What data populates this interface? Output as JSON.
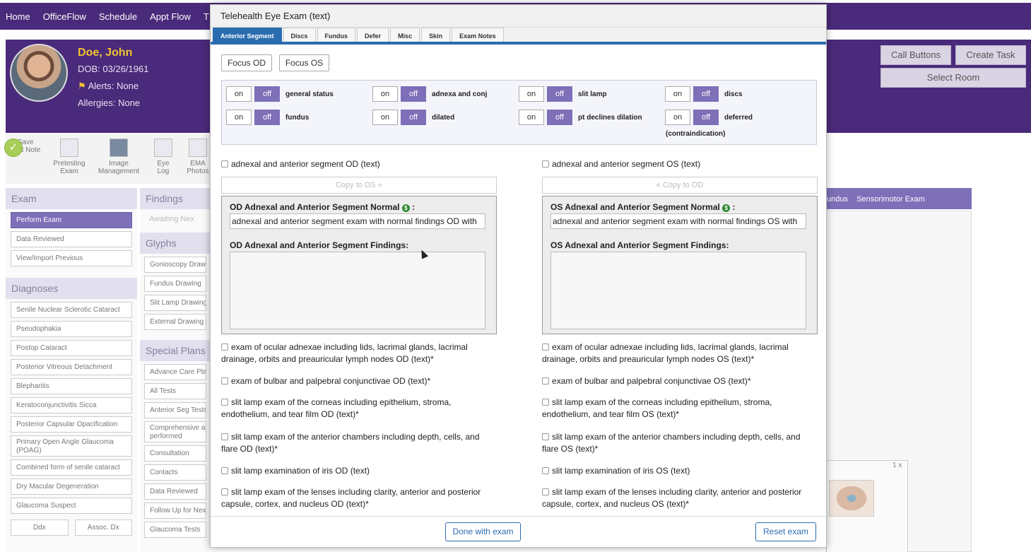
{
  "nav": {
    "items": [
      "Home",
      "OfficeFlow",
      "Schedule",
      "Appt Flow",
      "T"
    ]
  },
  "patient": {
    "name": "Doe, John",
    "dob": "DOB: 03/26/1961",
    "alerts": "Alerts: None",
    "allergies": "Allergies: None"
  },
  "header_buttons": {
    "call": "Call Buttons",
    "task": "Create Task",
    "room": "Select Room"
  },
  "toolbar": [
    {
      "label1": "Save",
      "label2": "Visit Note",
      "icon": "check-circle-icon"
    },
    {
      "label1": "Pretesting",
      "label2": "Exam",
      "icon": "clipboard-icon"
    },
    {
      "label1": "Image",
      "label2": "Management",
      "icon": "image-file-icon"
    },
    {
      "label1": "Eye",
      "label2": "Log",
      "icon": "calendar-icon"
    },
    {
      "label1": "EMA",
      "label2": "Photos",
      "icon": "photos-icon"
    }
  ],
  "left": {
    "exam_title": "Exam",
    "exam_items": [
      "Perform Exam",
      "Data Reviewed",
      "View/Import Previous"
    ],
    "diagnoses_title": "Diagnoses",
    "diagnoses": [
      "Senile Nuclear Sclerotic Cataract",
      "Pseudophakia",
      "Postop Cataract",
      "Posterior Vitreous Detachment",
      "Blepharitis",
      "Keratoconjunctivitis Sicca",
      "Posterior Capsular Opacification",
      "Primary Open Angle Glaucoma (POAG)",
      "Combined form of senile cataract",
      "Dry Macular Degeneration",
      "Glaucoma Suspect"
    ],
    "ddx": "Ddx",
    "assoc": "Assoc. Dx"
  },
  "mid": {
    "findings_title": "Findings",
    "awaiting": "Awaiting Nex",
    "glyphs_title": "Glyphs",
    "glyphs": [
      "Gonioscopy Drawi",
      "Fundus Drawing",
      "Slit Lamp Drawing",
      "External Drawing"
    ],
    "plans_title": "Special Plans",
    "plans": [
      "Advance Care Plan",
      "All Tests",
      "Anterior Seg Tests",
      "Comprehensive a performed",
      "Consultation",
      "Contacts",
      "Data Reviewed",
      "Follow Up for Nex",
      "Glaucoma Tests"
    ]
  },
  "right": {
    "tabs": "undus    Sensorimotor Exam",
    "zoom": "1 x"
  },
  "modal": {
    "title": "Telehealth Eye Exam (text)",
    "tabs": [
      "Anterior Segment",
      "Discs",
      "Fundus",
      "Defer",
      "Misc",
      "Skin",
      "Exam Notes"
    ],
    "focus_od": "Focus OD",
    "focus_os": "Focus OS",
    "on_label": "on",
    "off_label": "off",
    "toggles": [
      "general status",
      "adnexa and conj",
      "slit lamp",
      "discs",
      "fundus",
      "dilated",
      "pt declines dilation",
      "deferred"
    ],
    "toggle_sub": "(contraindication)",
    "od": {
      "check_main": "adnexal and anterior segment OD (text)",
      "copy": "Copy to OS »",
      "normal_title": "OD Adnexal and Anterior Segment Normal",
      "normal_value": "adnexal and anterior segment exam with normal findings OD with",
      "findings_title": "OD Adnexal and Anterior Segment Findings:",
      "checks": [
        "exam of ocular adnexae including lids, lacrimal glands, lacrimal drainage, orbits and preauricular lymph nodes OD (text)*",
        "exam of bulbar and palpebral conjunctivae OD (text)*",
        "slit lamp exam of the corneas including epithelium, stroma, endothelium, and tear film OD (text)*",
        "slit lamp exam of the anterior chambers including depth, cells, and flare OD (text)*",
        "slit lamp examination of iris OD (text)",
        "slit lamp exam of the lenses including clarity, anterior and posterior capsule, cortex, and nucleus OD (text)*"
      ]
    },
    "os": {
      "check_main": "adnexal and anterior segment OS (text)",
      "copy": "« Copy to OD",
      "normal_title": "OS Adnexal and Anterior Segment Normal",
      "normal_value": "adnexal and anterior segment exam with normal findings OS with",
      "findings_title": "OS Adnexal and Anterior Segment Findings:",
      "checks": [
        "exam of ocular adnexae including lids, lacrimal glands, lacrimal drainage, orbits and preauricular lymph nodes OS (text)*",
        "exam of bulbar and palpebral conjunctivae OS (text)*",
        "slit lamp exam of the corneas including epithelium, stroma, endothelium, and tear film OS (text)*",
        "slit lamp exam of the anterior chambers including depth, cells, and flare OS (text)*",
        "slit lamp examination of iris OS (text)",
        "slit lamp exam of the lenses including clarity, anterior and posterior capsule, cortex, and nucleus OS (text)*"
      ]
    },
    "done": "Done with exam",
    "reset": "Reset exam"
  },
  "colors": {
    "purple": "#4a2a7a",
    "accent": "#7e6fb8",
    "blue": "#2b6cb0",
    "name": "#f1c232"
  }
}
